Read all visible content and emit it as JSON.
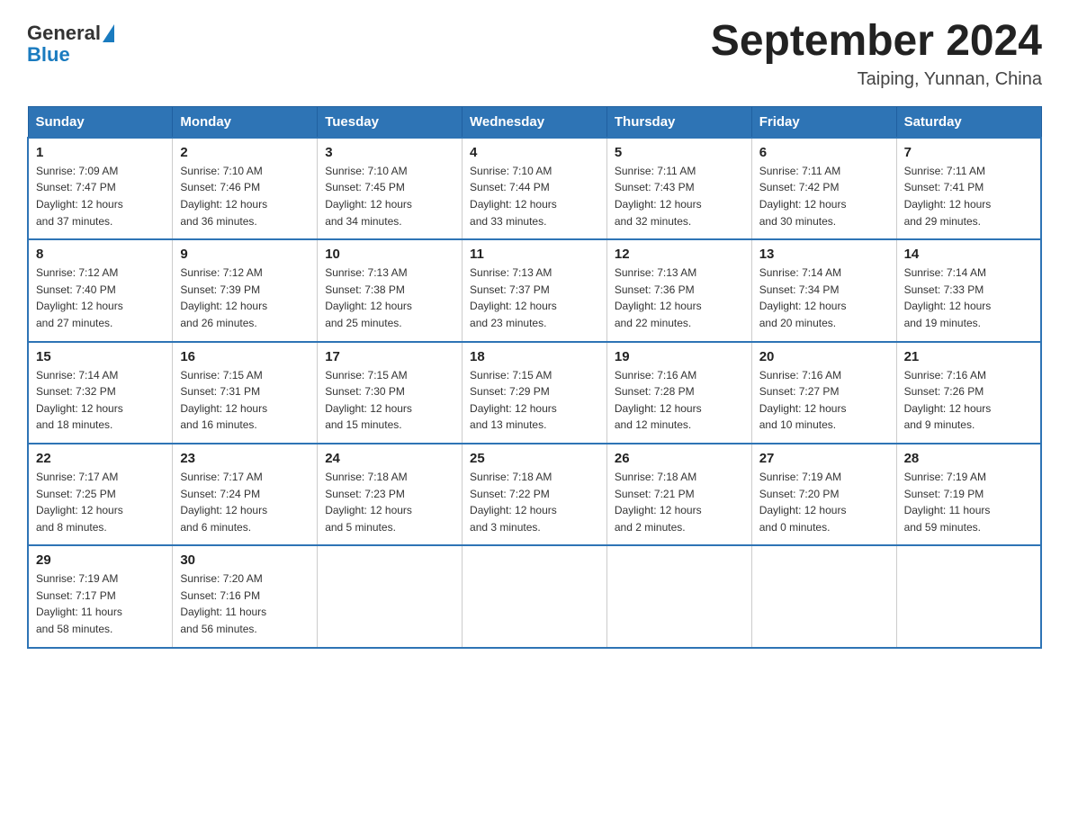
{
  "logo": {
    "text_general": "General",
    "text_blue": "Blue"
  },
  "title": "September 2024",
  "subtitle": "Taiping, Yunnan, China",
  "headers": [
    "Sunday",
    "Monday",
    "Tuesday",
    "Wednesday",
    "Thursday",
    "Friday",
    "Saturday"
  ],
  "weeks": [
    [
      {
        "day": "1",
        "sunrise": "7:09 AM",
        "sunset": "7:47 PM",
        "daylight": "12 hours and 37 minutes."
      },
      {
        "day": "2",
        "sunrise": "7:10 AM",
        "sunset": "7:46 PM",
        "daylight": "12 hours and 36 minutes."
      },
      {
        "day": "3",
        "sunrise": "7:10 AM",
        "sunset": "7:45 PM",
        "daylight": "12 hours and 34 minutes."
      },
      {
        "day": "4",
        "sunrise": "7:10 AM",
        "sunset": "7:44 PM",
        "daylight": "12 hours and 33 minutes."
      },
      {
        "day": "5",
        "sunrise": "7:11 AM",
        "sunset": "7:43 PM",
        "daylight": "12 hours and 32 minutes."
      },
      {
        "day": "6",
        "sunrise": "7:11 AM",
        "sunset": "7:42 PM",
        "daylight": "12 hours and 30 minutes."
      },
      {
        "day": "7",
        "sunrise": "7:11 AM",
        "sunset": "7:41 PM",
        "daylight": "12 hours and 29 minutes."
      }
    ],
    [
      {
        "day": "8",
        "sunrise": "7:12 AM",
        "sunset": "7:40 PM",
        "daylight": "12 hours and 27 minutes."
      },
      {
        "day": "9",
        "sunrise": "7:12 AM",
        "sunset": "7:39 PM",
        "daylight": "12 hours and 26 minutes."
      },
      {
        "day": "10",
        "sunrise": "7:13 AM",
        "sunset": "7:38 PM",
        "daylight": "12 hours and 25 minutes."
      },
      {
        "day": "11",
        "sunrise": "7:13 AM",
        "sunset": "7:37 PM",
        "daylight": "12 hours and 23 minutes."
      },
      {
        "day": "12",
        "sunrise": "7:13 AM",
        "sunset": "7:36 PM",
        "daylight": "12 hours and 22 minutes."
      },
      {
        "day": "13",
        "sunrise": "7:14 AM",
        "sunset": "7:34 PM",
        "daylight": "12 hours and 20 minutes."
      },
      {
        "day": "14",
        "sunrise": "7:14 AM",
        "sunset": "7:33 PM",
        "daylight": "12 hours and 19 minutes."
      }
    ],
    [
      {
        "day": "15",
        "sunrise": "7:14 AM",
        "sunset": "7:32 PM",
        "daylight": "12 hours and 18 minutes."
      },
      {
        "day": "16",
        "sunrise": "7:15 AM",
        "sunset": "7:31 PM",
        "daylight": "12 hours and 16 minutes."
      },
      {
        "day": "17",
        "sunrise": "7:15 AM",
        "sunset": "7:30 PM",
        "daylight": "12 hours and 15 minutes."
      },
      {
        "day": "18",
        "sunrise": "7:15 AM",
        "sunset": "7:29 PM",
        "daylight": "12 hours and 13 minutes."
      },
      {
        "day": "19",
        "sunrise": "7:16 AM",
        "sunset": "7:28 PM",
        "daylight": "12 hours and 12 minutes."
      },
      {
        "day": "20",
        "sunrise": "7:16 AM",
        "sunset": "7:27 PM",
        "daylight": "12 hours and 10 minutes."
      },
      {
        "day": "21",
        "sunrise": "7:16 AM",
        "sunset": "7:26 PM",
        "daylight": "12 hours and 9 minutes."
      }
    ],
    [
      {
        "day": "22",
        "sunrise": "7:17 AM",
        "sunset": "7:25 PM",
        "daylight": "12 hours and 8 minutes."
      },
      {
        "day": "23",
        "sunrise": "7:17 AM",
        "sunset": "7:24 PM",
        "daylight": "12 hours and 6 minutes."
      },
      {
        "day": "24",
        "sunrise": "7:18 AM",
        "sunset": "7:23 PM",
        "daylight": "12 hours and 5 minutes."
      },
      {
        "day": "25",
        "sunrise": "7:18 AM",
        "sunset": "7:22 PM",
        "daylight": "12 hours and 3 minutes."
      },
      {
        "day": "26",
        "sunrise": "7:18 AM",
        "sunset": "7:21 PM",
        "daylight": "12 hours and 2 minutes."
      },
      {
        "day": "27",
        "sunrise": "7:19 AM",
        "sunset": "7:20 PM",
        "daylight": "12 hours and 0 minutes."
      },
      {
        "day": "28",
        "sunrise": "7:19 AM",
        "sunset": "7:19 PM",
        "daylight": "11 hours and 59 minutes."
      }
    ],
    [
      {
        "day": "29",
        "sunrise": "7:19 AM",
        "sunset": "7:17 PM",
        "daylight": "11 hours and 58 minutes."
      },
      {
        "day": "30",
        "sunrise": "7:20 AM",
        "sunset": "7:16 PM",
        "daylight": "11 hours and 56 minutes."
      },
      null,
      null,
      null,
      null,
      null
    ]
  ]
}
